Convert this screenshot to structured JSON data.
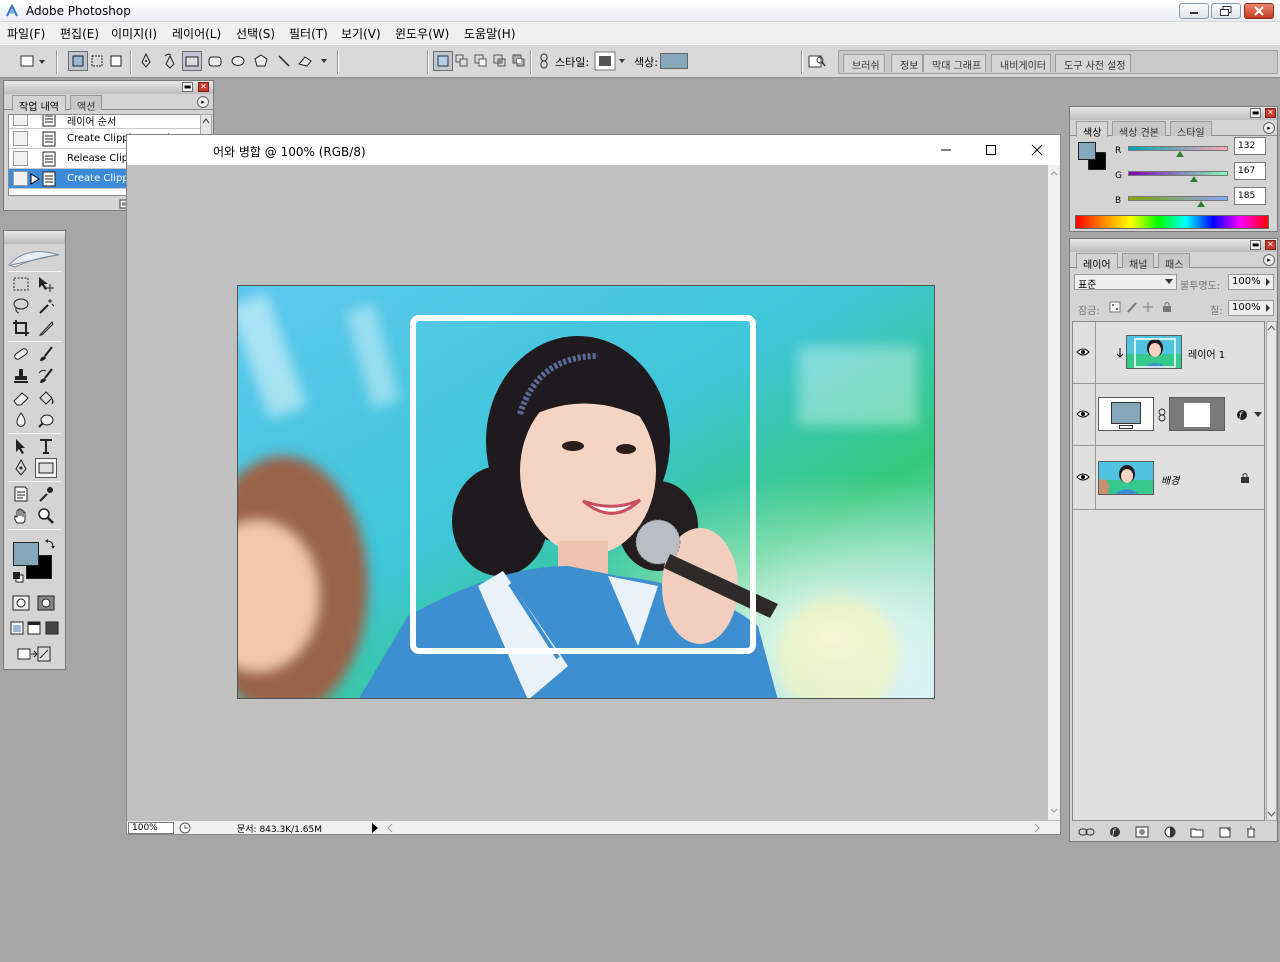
{
  "app": {
    "title": "Adobe Photoshop"
  },
  "menu": [
    "파일(F)",
    "편집(E)",
    "이미지(I)",
    "레이어(L)",
    "선택(S)",
    "필터(T)",
    "보기(V)",
    "윈도우(W)",
    "도움말(H)"
  ],
  "options": {
    "style_label": "스타일:",
    "color_label": "색상:",
    "color_value": "#84a7b9",
    "palette_well_tabs": [
      "브러쉬",
      "정보",
      "막대 그래프",
      "내비게이터",
      "도구 사전 설정"
    ]
  },
  "history": {
    "tabs": [
      "작업 내역",
      "액션"
    ],
    "items": [
      "레이어 순서",
      "Create Clipping Mask",
      "Release Clipping Mask",
      "Create Clipping Mask"
    ],
    "selected_index": 3
  },
  "document": {
    "title": "어와 병합 @ 100% (RGB/8)",
    "zoom": "100%",
    "doc_info": "문서: 843.3K/1.65M"
  },
  "color_panel": {
    "tabs": [
      "색상",
      "색상 견본",
      "스타일"
    ],
    "channels": [
      {
        "label": "R",
        "value": "132",
        "fraction": 0.52
      },
      {
        "label": "G",
        "value": "167",
        "fraction": 0.655
      },
      {
        "label": "B",
        "value": "185",
        "fraction": 0.725
      }
    ],
    "foreground": "#84a7b9",
    "background": "#000000"
  },
  "layers_panel": {
    "tabs": [
      "레이어",
      "채널",
      "패스"
    ],
    "blend_mode": "표준",
    "opacity_label": "불투명도:",
    "opacity_value": "100%",
    "lock_label": "잠금:",
    "fill_label": "칠:",
    "fill_value": "100%",
    "layers": [
      {
        "name": "레이어 1",
        "clipped": true
      },
      {
        "name": "",
        "type": "shape"
      },
      {
        "name": "배경",
        "locked": true
      }
    ]
  }
}
